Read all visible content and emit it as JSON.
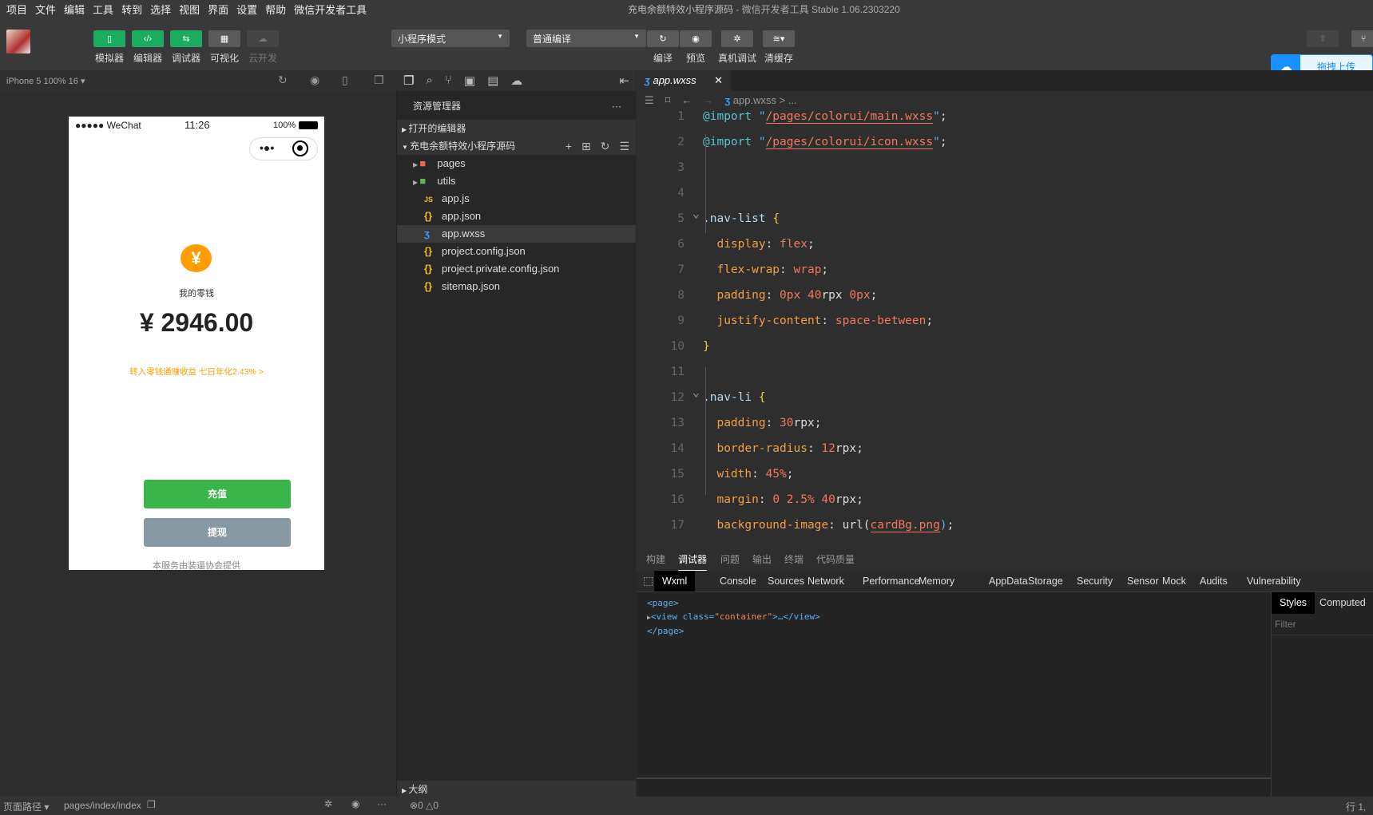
{
  "menu": [
    "项目",
    "文件",
    "编辑",
    "工具",
    "转到",
    "选择",
    "视图",
    "界面",
    "设置",
    "帮助",
    "微信开发者工具"
  ],
  "window_title": {
    "project": "充电余额特效小程序源码",
    "app": " - 微信开发者工具 Stable 1.06.2303220"
  },
  "toolbar": {
    "left": [
      {
        "label": "模拟器",
        "icon": "phone-icon",
        "glyph": "▯"
      },
      {
        "label": "编辑器",
        "icon": "code-icon",
        "glyph": "‹/›"
      },
      {
        "label": "调试器",
        "icon": "debug-icon",
        "glyph": "⇆"
      },
      {
        "label": "可视化",
        "icon": "layout-icon",
        "glyph": "▦"
      },
      {
        "label": "云开发",
        "icon": "cloud-icon",
        "glyph": "☁"
      }
    ],
    "mode_select": "小程序模式",
    "compile_select": "普通编译",
    "right": [
      {
        "label": "编译",
        "icon": "refresh-icon",
        "glyph": "↻"
      },
      {
        "label": "预览",
        "icon": "eye-icon",
        "glyph": "◉"
      },
      {
        "label": "真机调试",
        "icon": "bug-icon",
        "glyph": "✲"
      },
      {
        "label": "清缓存",
        "icon": "layers-icon",
        "glyph": "≋▾"
      }
    ],
    "upload_popup": "拖拽上传"
  },
  "simulator": {
    "device": "iPhone 5 100% 16 ▾",
    "phone": {
      "carrier": "●●●●● WeChat",
      "time": "11:26",
      "battery": "100%",
      "coin": "¥",
      "label": "我的零钱",
      "amount": "¥ 2946.00",
      "link": "转入零钱通赚收益 七日年化2.43% >",
      "recharge": "充值",
      "withdraw": "提现",
      "footer": "本服务由装逼协会提供"
    }
  },
  "explorer": {
    "title": "资源管理器",
    "more": "···",
    "open_editors": "打开的编辑器",
    "project": "充电余额特效小程序源码",
    "files": [
      {
        "name": "pages",
        "icon": "folder-icon",
        "color": "#f06848",
        "folder": true
      },
      {
        "name": "utils",
        "icon": "folder-icon",
        "color": "#6ab04c",
        "folder": true
      },
      {
        "name": "app.js",
        "icon": "js-icon",
        "color": "#f0c020"
      },
      {
        "name": "app.json",
        "icon": "json-icon",
        "color": "#f0c020"
      },
      {
        "name": "app.wxss",
        "icon": "css-icon",
        "color": "#3c9cf0",
        "selected": true
      },
      {
        "name": "project.config.json",
        "icon": "json-icon",
        "color": "#f0c020"
      },
      {
        "name": "project.private.config.json",
        "icon": "json-icon",
        "color": "#f0c020"
      },
      {
        "name": "sitemap.json",
        "icon": "json-icon",
        "color": "#f0c020"
      }
    ],
    "outline": "大纲"
  },
  "editor": {
    "tab": "app.wxss",
    "breadcrumb": "app.wxss > ...",
    "lines": [
      [
        [
          "@import",
          "at"
        ],
        [
          " ",
          "t"
        ],
        [
          "\"",
          "q"
        ],
        [
          "/pages/colorui/main.wxss",
          "str"
        ],
        [
          "\"",
          "q"
        ],
        [
          ";",
          "t"
        ]
      ],
      [
        [
          "@import",
          "at"
        ],
        [
          " ",
          "t"
        ],
        [
          "\"",
          "q"
        ],
        [
          "/pages/colorui/icon.wxss",
          "str"
        ],
        [
          "\"",
          "q"
        ],
        [
          ";",
          "t"
        ]
      ],
      [],
      [],
      [
        [
          ".nav-list",
          "sel"
        ],
        [
          " ",
          "t"
        ],
        [
          "{",
          "br"
        ]
      ],
      [
        [
          "  display",
          "p"
        ],
        [
          ": ",
          "t"
        ],
        [
          "flex",
          "v"
        ],
        [
          ";",
          "t"
        ]
      ],
      [
        [
          "  flex-wrap",
          "p"
        ],
        [
          ": ",
          "t"
        ],
        [
          "wrap",
          "v"
        ],
        [
          ";",
          "t"
        ]
      ],
      [
        [
          "  padding",
          "p"
        ],
        [
          ": ",
          "t"
        ],
        [
          "0px 40",
          "v"
        ],
        [
          "rpx ",
          "t"
        ],
        [
          "0px",
          "v"
        ],
        [
          ";",
          "t"
        ]
      ],
      [
        [
          "  justify-content",
          "p"
        ],
        [
          ": ",
          "t"
        ],
        [
          "space-between",
          "v"
        ],
        [
          ";",
          "t"
        ]
      ],
      [
        [
          "}",
          "br"
        ]
      ],
      [],
      [
        [
          ".nav-li",
          "sel"
        ],
        [
          " ",
          "t"
        ],
        [
          "{",
          "br"
        ]
      ],
      [
        [
          "  padding",
          "p"
        ],
        [
          ": ",
          "t"
        ],
        [
          "30",
          "v"
        ],
        [
          "rpx;",
          "t"
        ]
      ],
      [
        [
          "  border-radius",
          "p"
        ],
        [
          ": ",
          "t"
        ],
        [
          "12",
          "v"
        ],
        [
          "rpx;",
          "t"
        ]
      ],
      [
        [
          "  width",
          "p"
        ],
        [
          ": ",
          "t"
        ],
        [
          "45%",
          "v"
        ],
        [
          ";",
          "t"
        ]
      ],
      [
        [
          "  margin",
          "p"
        ],
        [
          ": ",
          "t"
        ],
        [
          "0 2.5% 40",
          "v"
        ],
        [
          "rpx;",
          "t"
        ]
      ],
      [
        [
          "  background-image",
          "p"
        ],
        [
          ": ",
          "t"
        ],
        [
          "url(",
          "t"
        ],
        [
          "cardBg.png",
          "str"
        ],
        [
          ")",
          "q"
        ],
        [
          ";",
          "t"
        ]
      ]
    ]
  },
  "panel": {
    "tabs": [
      "构建",
      "调试器",
      "问题",
      "输出",
      "终端",
      "代码质量"
    ],
    "active_tab": "调试器",
    "devtools": [
      "Wxml",
      "Console",
      "Sources",
      "Network",
      "Performance",
      "Memory",
      "AppData",
      "Storage",
      "Security",
      "Sensor",
      "Mock",
      "Audits",
      "Vulnerability"
    ],
    "wxml": {
      "open": "<page>",
      "view_open": "<view class=",
      "view_class": "\"container\"",
      "view_close": ">…</view>",
      "close": "</page>"
    },
    "styles_tabs": [
      "Styles",
      "Computed"
    ],
    "filter": "Filter"
  },
  "status": {
    "page_path_label": "页面路径 ▾",
    "page_path": "pages/index/index",
    "errors": "0",
    "warnings": "0",
    "cursor": "行 1,"
  }
}
